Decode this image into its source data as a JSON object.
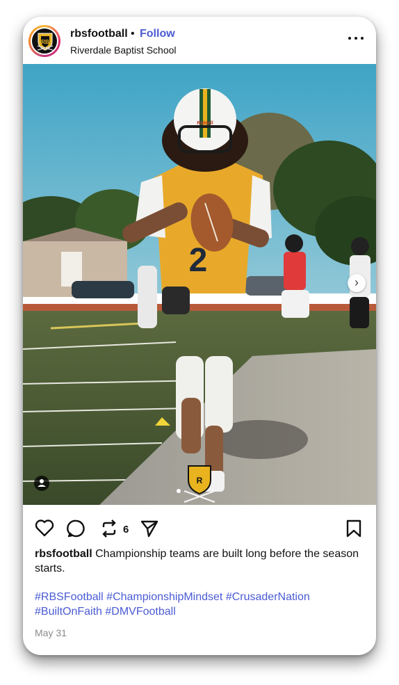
{
  "post": {
    "username": "rbsfootball",
    "separator": "•",
    "follow_label": "Follow",
    "location": "Riverdale Baptist School",
    "more_icon": "more-horizontal-icon",
    "jersey_number": "2",
    "helmet_brand": "Riddell",
    "actions": {
      "like_icon": "heart-icon",
      "comment_icon": "comment-icon",
      "repost_icon": "repost-icon",
      "repost_count": "6",
      "share_icon": "send-icon",
      "save_icon": "bookmark-icon"
    },
    "caption_username": "rbsfootball",
    "caption_text": " Championship teams are built long before the season starts.",
    "hashtags_line1": "#RBSFootball #ChampionshipMindset #CrusaderNation",
    "hashtags_line2": "#BuiltOnFaith #DMVFootball",
    "date": "May 31"
  },
  "colors": {
    "follow": "#4a5bd4",
    "hashtag": "#4a5bd4",
    "jersey_gold": "#e8a92a",
    "helmet_green": "#1f5a34"
  }
}
